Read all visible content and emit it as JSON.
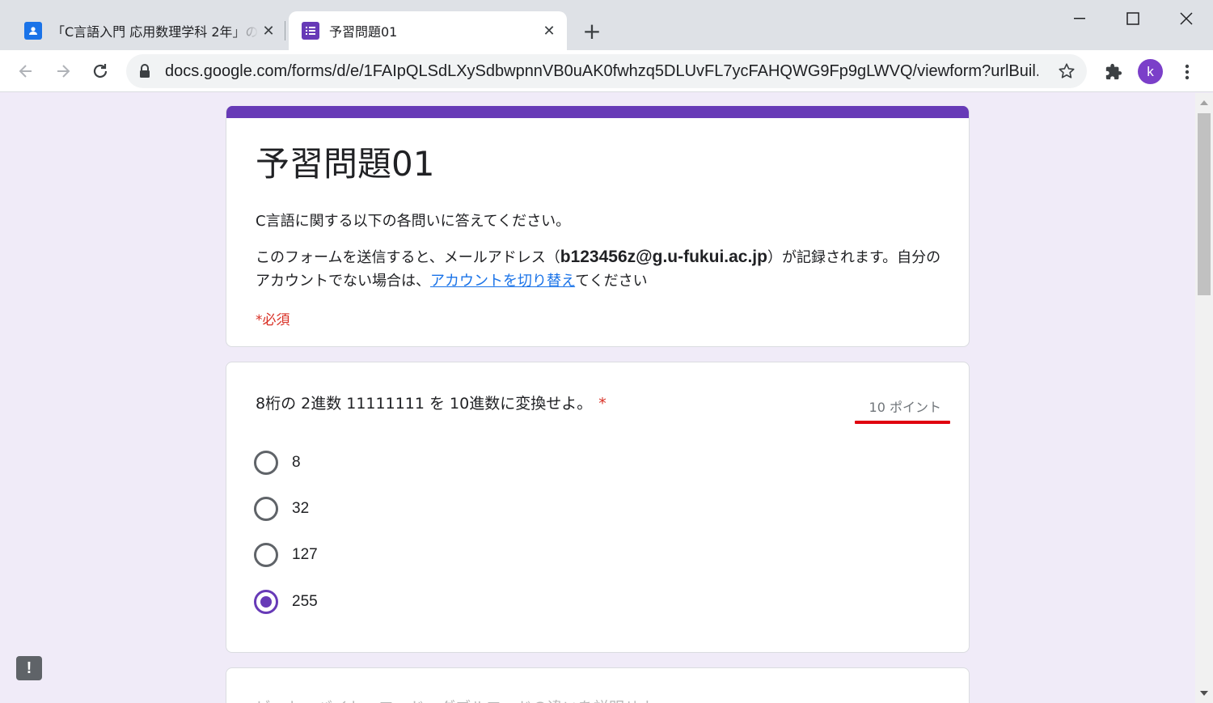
{
  "browser": {
    "tabs": [
      {
        "label": "「C言語入門 応用数理学科 2年」の",
        "icon": "classroom-icon",
        "active": false
      },
      {
        "label": "予習問題01",
        "icon": "forms-icon",
        "active": true
      }
    ],
    "new_tab": "+",
    "url": "docs.google.com/forms/d/e/1FAIpQLSdLXySdbwpnnVB0uAK0fwhzq5DLUvFL7ycFAHQWG9Fp9gLWVQ/viewform?urlBuil...",
    "profile_initial": "k",
    "colors": {
      "accent": "#673ab7",
      "avatar": "#7b3fc9",
      "required": "#d93025",
      "link": "#1a73e8"
    }
  },
  "form": {
    "title": "予習問題01",
    "description": "C言語に関する以下の各問いに答えてください。",
    "notice_pre": "このフォームを送信すると、メールアドレス（",
    "email": "b123456z@g.u-fukui.ac.jp",
    "notice_mid": "）が記録されます。自分のアカウントでない場合は、",
    "switch_account_link": "アカウントを切り替え",
    "notice_post": "てください",
    "required_note": "*必須"
  },
  "question1": {
    "text": "8桁の 2進数 11111111 を 10進数に変換せよ。",
    "required_mark": "*",
    "points": "10 ポイント",
    "options": [
      {
        "label": "8",
        "selected": false
      },
      {
        "label": "32",
        "selected": false
      },
      {
        "label": "127",
        "selected": false
      },
      {
        "label": "255",
        "selected": true
      }
    ]
  },
  "question2": {
    "text": "ビット・バイト・ワード・ダブルワードの違いを説明せよ。"
  },
  "feedback_icon": "!"
}
